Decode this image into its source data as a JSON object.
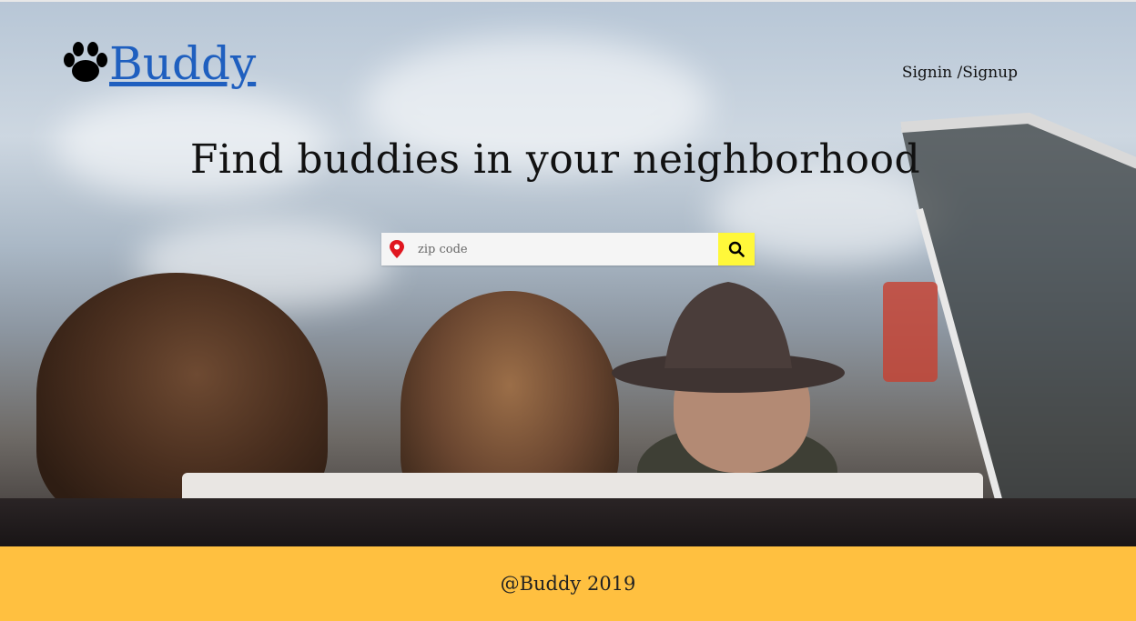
{
  "header": {
    "logo_text": "Buddy",
    "logo_icon": "paw-icon",
    "auth_link": "Signin /Signup"
  },
  "hero": {
    "headline": "Find buddies in your neighborhood"
  },
  "search": {
    "placeholder": "zip code",
    "value": "",
    "location_icon": "map-pin-icon",
    "button_icon": "search-icon"
  },
  "footer": {
    "text": "@Buddy 2019"
  },
  "colors": {
    "footer_bg": "#ffc040",
    "search_button": "#fff83a",
    "logo_link": "#1f5fbf",
    "pin": "#e0161f"
  }
}
